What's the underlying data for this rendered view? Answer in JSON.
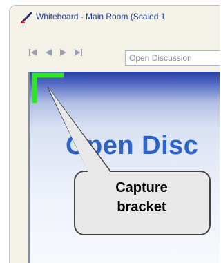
{
  "window": {
    "title": "Whiteboard - Main Room (Scaled 1"
  },
  "toolbar": {
    "slide_select_value": "Open Discussion",
    "buttons": [
      "first-slide",
      "previous-slide",
      "next-slide",
      "last-slide"
    ]
  },
  "slide": {
    "title": "Open Disc"
  },
  "annotation": {
    "line1": "Capture",
    "line2": "bracket"
  },
  "colors": {
    "bracket": "#2ee81f",
    "title_text": "#1f3f8c",
    "slide_title": "#2a62c9",
    "callout_fill": "#e8e8e8"
  }
}
